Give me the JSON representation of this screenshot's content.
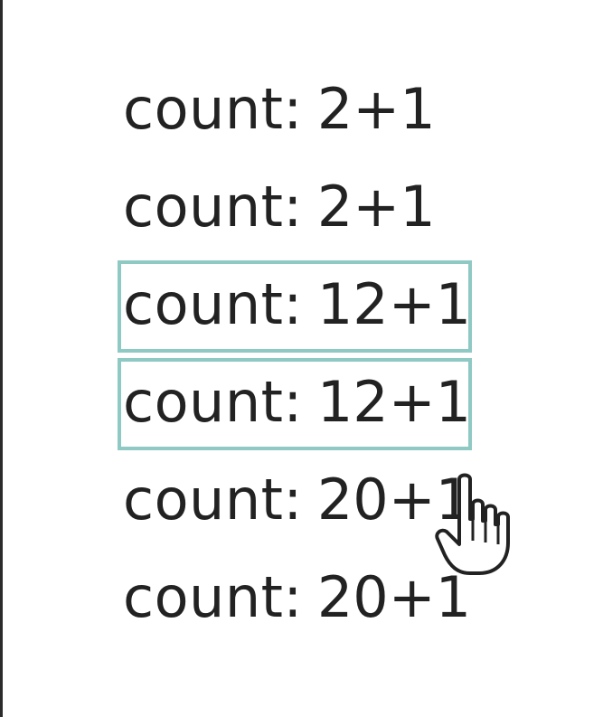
{
  "rows": [
    {
      "label": "count:",
      "value": "2+1",
      "highlighted": false
    },
    {
      "label": "count:",
      "value": "2+1",
      "highlighted": false
    },
    {
      "label": "count:",
      "value": "12+1",
      "highlighted": true
    },
    {
      "label": "count:",
      "value": "12+1",
      "highlighted": true
    },
    {
      "label": "count:",
      "value": "20+1",
      "highlighted": false
    },
    {
      "label": "count:",
      "value": "20+1",
      "highlighted": false
    }
  ],
  "colors": {
    "text": "#222222",
    "highlight_border": "#8fc9c3",
    "background": "#ffffff"
  },
  "cursor": {
    "icon": "hand-pointer-icon"
  }
}
